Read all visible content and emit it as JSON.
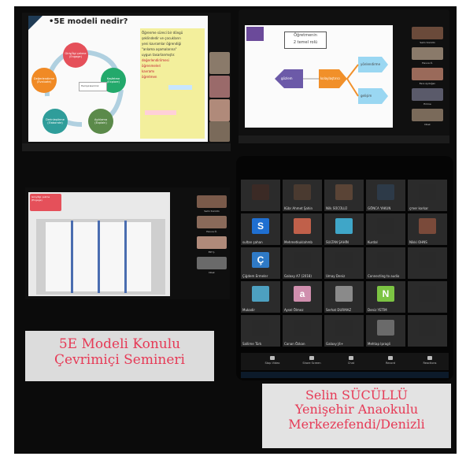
{
  "captions": {
    "left": [
      "5E Modeli Konulu",
      "Çevrimiçi Semineri"
    ],
    "right": [
      "Selin SÜCÜLLÜ",
      "Yenişehir Anaokulu",
      "Merkezefendi/Denizli"
    ]
  },
  "panel1": {
    "title": "•5E modeli nedir?",
    "cycle": [
      {
        "label": "Giriş/İlgi çekme (Engage)",
        "color": "#e5505a"
      },
      {
        "label": "Keşfetme (Explore)",
        "color": "#23a96b"
      },
      {
        "label": "Açıklama (Explain)",
        "color": "#5b8a4a"
      },
      {
        "label": "Derinleştirme (Elaborate)",
        "color": "#2f9d9a"
      },
      {
        "label": "Değerlendirme (Evaluate)",
        "color": "#f08a25"
      }
    ],
    "popup_label": "Hemşirelerimiz",
    "side_lines": [
      "Öğrenme süreci bir döngü",
      "şeklindedir ve çocukların",
      "yeni kavramlar öğrendiği",
      "\"anlama aşamalarına\"",
      "uygun tasarlanmıştır."
    ],
    "keyword_labels": [
      "değerlendirilmesi",
      "öğrenmeleri",
      "kavramı",
      "öğretmen"
    ]
  },
  "panel2": {
    "box_title": [
      "Öğretmenin",
      "2 temel rolü"
    ],
    "shapes": [
      "gözlem",
      "kolaylaştırıcı",
      "yönlendirme",
      "gelişim"
    ],
    "participants": [
      "Selin Sücüllü",
      "Havva Ö.",
      "Esra Aydoğan",
      "Emine",
      "Dilek"
    ]
  },
  "panel3": {
    "slide_label": "Giriş/İlgi çekme (Engage)",
    "participants": [
      "Selin Sücüllü",
      "Havva Ö.",
      "Elif Ç.",
      "Dilek"
    ]
  },
  "panel4": {
    "top_names": [
      "Kübr Ahmet Şahin",
      "Nilk SÜCÜLLÜ",
      "GÖNCA YAKUN"
    ],
    "tiles": [
      {
        "name": "",
        "letter": "",
        "color": "#3b2a25"
      },
      {
        "name": "Kübr Ahmet Şahin",
        "letter": "",
        "color": "#4a3a30"
      },
      {
        "name": "Nilk SÜCÜLLÜ",
        "letter": "",
        "color": "#5a4436"
      },
      {
        "name": "GÖNCA YAKUN",
        "letter": "",
        "color": "#2d3a48"
      },
      {
        "name": "çmer korkar",
        "letter": "",
        "color": "#2a2a2a"
      },
      {
        "name": "sultan şahan",
        "letter": "S",
        "color": "#1f6fd1"
      },
      {
        "name": "Mehmetkuklahmb",
        "letter": "",
        "color": "#c0604a"
      },
      {
        "name": "SULTAN ŞAHİN",
        "letter": "",
        "color": "#3fa6c8"
      },
      {
        "name": "Kurdal",
        "letter": "",
        "color": "#2a2a2a"
      },
      {
        "name": "Nikki OHNS",
        "letter": "",
        "color": "#7a4a3a"
      },
      {
        "name": "Çiğdem Ermeler",
        "letter": "Ç",
        "color": "#2f7ac6"
      },
      {
        "name": "Galaxy A7 (2018)",
        "letter": "",
        "color": "#2a2a2a"
      },
      {
        "name": "Umay Deniz",
        "letter": "",
        "color": "#2a2a2a"
      },
      {
        "name": "Connecting to audio",
        "letter": "",
        "color": "#2a2a2a"
      },
      {
        "name": "",
        "letter": "",
        "color": "#2a2a2a"
      },
      {
        "name": "Mukadir",
        "letter": "",
        "color": "#4da0c0"
      },
      {
        "name": "Aysel Ölmez",
        "letter": "a",
        "color": "#d08fae"
      },
      {
        "name": "Serhat DURMAZ",
        "letter": "",
        "color": "#8a8a8a"
      },
      {
        "name": "Deniz YETİM",
        "letter": "N",
        "color": "#7cc443"
      },
      {
        "name": "",
        "letter": "",
        "color": "#2a2a2a"
      },
      {
        "name": "Sallime Türk",
        "letter": "",
        "color": "#2a2a2a"
      },
      {
        "name": "Canan Özkan",
        "letter": "",
        "color": "#2a2a2a"
      },
      {
        "name": "Galaxy J4+",
        "letter": "",
        "color": "#2a2a2a"
      },
      {
        "name": "Mehtap Ipragli",
        "letter": "",
        "color": "#6a6a6a"
      },
      {
        "name": "",
        "letter": "",
        "color": "#2a2a2a"
      }
    ],
    "toolbar": [
      "Stop Video",
      "Share Screen",
      "Chat",
      "Record",
      "Reactions"
    ]
  }
}
